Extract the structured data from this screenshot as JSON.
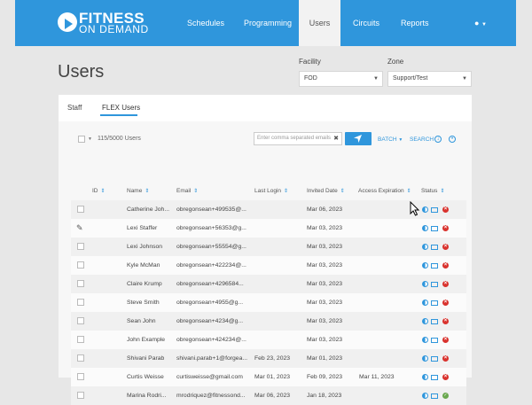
{
  "brand": {
    "line1": "FITNESS",
    "line2": "ON DEMAND"
  },
  "nav": [
    "Schedules",
    "Programming",
    "Users",
    "Circuits",
    "Reports"
  ],
  "page_title": "Users",
  "filters": {
    "facility_label": "Facility",
    "facility_value": "FOD",
    "zone_label": "Zone",
    "zone_value": "Support/Test"
  },
  "tabs": [
    "Staff",
    "FLEX Users"
  ],
  "toolbar": {
    "count": "115/5000 Users",
    "email_placeholder": "Enter comma separated emails",
    "clear": "✖",
    "batch": "BATCH",
    "search": "SEARCH"
  },
  "columns": [
    "ID",
    "Name",
    "Email",
    "Last Login",
    "Invited Date",
    "Access Expiration",
    "Status"
  ],
  "rows": [
    {
      "name": "Catherine Joh...",
      "email": "obregonsean+499535@...",
      "last_login": "",
      "invited": "Mar 06, 2023",
      "expiration": ""
    },
    {
      "name": "Lexi Staffer",
      "email": "obregonsean+56353@g...",
      "last_login": "",
      "invited": "Mar 03, 2023",
      "expiration": ""
    },
    {
      "name": "Lexi Johnson",
      "email": "obregonsean+55554@g...",
      "last_login": "",
      "invited": "Mar 03, 2023",
      "expiration": ""
    },
    {
      "name": "Kyle McMan",
      "email": "obregonsean+422234@...",
      "last_login": "",
      "invited": "Mar 03, 2023",
      "expiration": ""
    },
    {
      "name": "Claire Krump",
      "email": "obregonsean+4296584...",
      "last_login": "",
      "invited": "Mar 03, 2023",
      "expiration": ""
    },
    {
      "name": "Steve Smith",
      "email": "obregonsean+4955@g...",
      "last_login": "",
      "invited": "Mar 03, 2023",
      "expiration": ""
    },
    {
      "name": "Sean John",
      "email": "obregonsean+4234@g...",
      "last_login": "",
      "invited": "Mar 03, 2023",
      "expiration": ""
    },
    {
      "name": "John Example",
      "email": "obregonsean+424234@...",
      "last_login": "",
      "invited": "Mar 03, 2023",
      "expiration": ""
    },
    {
      "name": "Shivani Parab",
      "email": "shivani.parab+1@forgea...",
      "last_login": "Feb 23, 2023",
      "invited": "Mar 01, 2023",
      "expiration": ""
    },
    {
      "name": "Curtis Weisse",
      "email": "curtisweisse@gmail.com",
      "last_login": "Mar 01, 2023",
      "invited": "Feb 09, 2023",
      "expiration": "Mar 11, 2023"
    },
    {
      "name": "Marina Rodri...",
      "email": "mrodriquez@fitnessond...",
      "last_login": "Mar 06, 2023",
      "invited": "Jan 18, 2023",
      "expiration": ""
    }
  ],
  "colors": {
    "brand_blue": "#2f96dc",
    "error_red": "#d9322d",
    "ok_green": "#6aa84f"
  }
}
